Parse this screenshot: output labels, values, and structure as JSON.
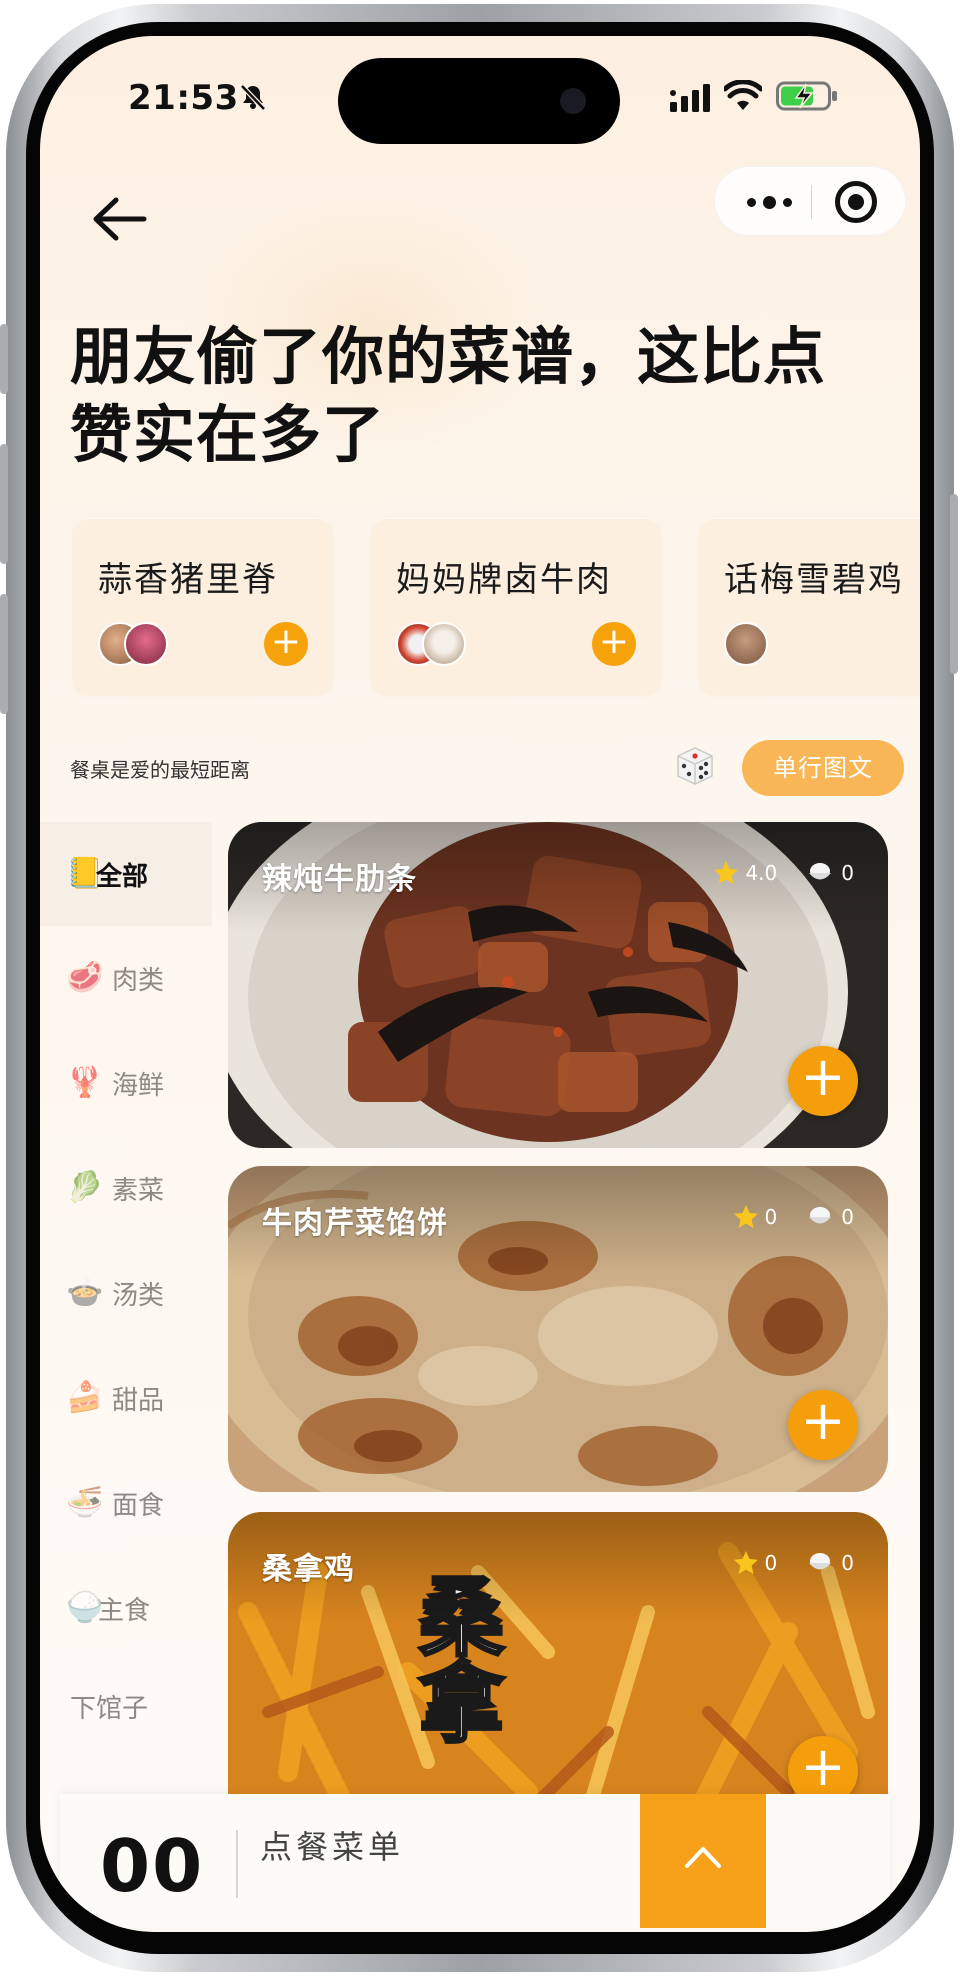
{
  "status_bar": {
    "time": "21:53"
  },
  "headline": "朋友偷了你的菜谱，这比点赞实在多了",
  "featured": [
    {
      "title": "蒜香猪里脊"
    },
    {
      "title": "妈妈牌卤牛肉"
    },
    {
      "title": "话梅雪碧鸡"
    }
  ],
  "tagline": "餐桌是爱的最短距离",
  "layout_toggle_label": "单行图文",
  "categories": [
    {
      "emoji": "📒",
      "label": "全部",
      "active": true
    },
    {
      "emoji": "🥩",
      "label": "肉类"
    },
    {
      "emoji": "🦞",
      "label": "海鲜"
    },
    {
      "emoji": "🥬",
      "label": "素菜"
    },
    {
      "emoji": "🍲",
      "label": "汤类"
    },
    {
      "emoji": "🍰",
      "label": "甜品"
    },
    {
      "emoji": "🍜",
      "label": "面食"
    },
    {
      "emoji": "🍚",
      "label": "主食"
    },
    {
      "emoji": "",
      "label": "下馆子"
    }
  ],
  "dishes": [
    {
      "title": "辣炖牛肋条",
      "rating": "4.0",
      "orders": "0"
    },
    {
      "title": "牛肉芹菜馅饼",
      "rating": "0",
      "orders": "0"
    },
    {
      "title": "桑拿鸡",
      "rating": "0",
      "orders": "0"
    }
  ],
  "dish_photo_overlay_text": "桑拿",
  "order_bar": {
    "count": "00",
    "label": "点餐菜单"
  },
  "colors": {
    "accent": "#f59e0b",
    "toggle": "#f8b656",
    "background": "#fdf4ea"
  }
}
